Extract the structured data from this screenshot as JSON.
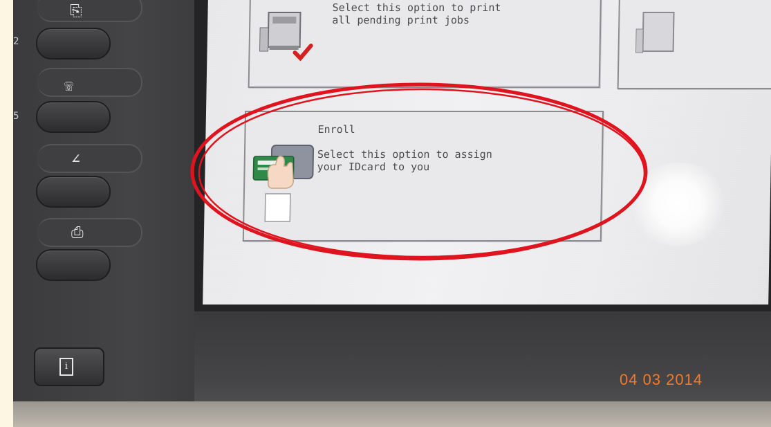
{
  "screen": {
    "print_tile": {
      "description_line1": "Select this option to print",
      "description_line2": "all pending print jobs"
    },
    "enroll_tile": {
      "title": "Enroll",
      "description_line1": "Select this option to assign",
      "description_line2": "your IDcard to you"
    }
  },
  "panel": {
    "icons": [
      "document-send-icon",
      "fax-icon",
      "scan-icon",
      "print-icon",
      "info-icon"
    ],
    "tick_labels": [
      "2",
      "5"
    ]
  },
  "photo_date_stamp": "04 03 2014",
  "colors": {
    "highlight_ellipse": "#e0141e",
    "date_stamp": "#f07a2a",
    "checkmark": "#d62020",
    "id_card": "#2f8a4a"
  }
}
